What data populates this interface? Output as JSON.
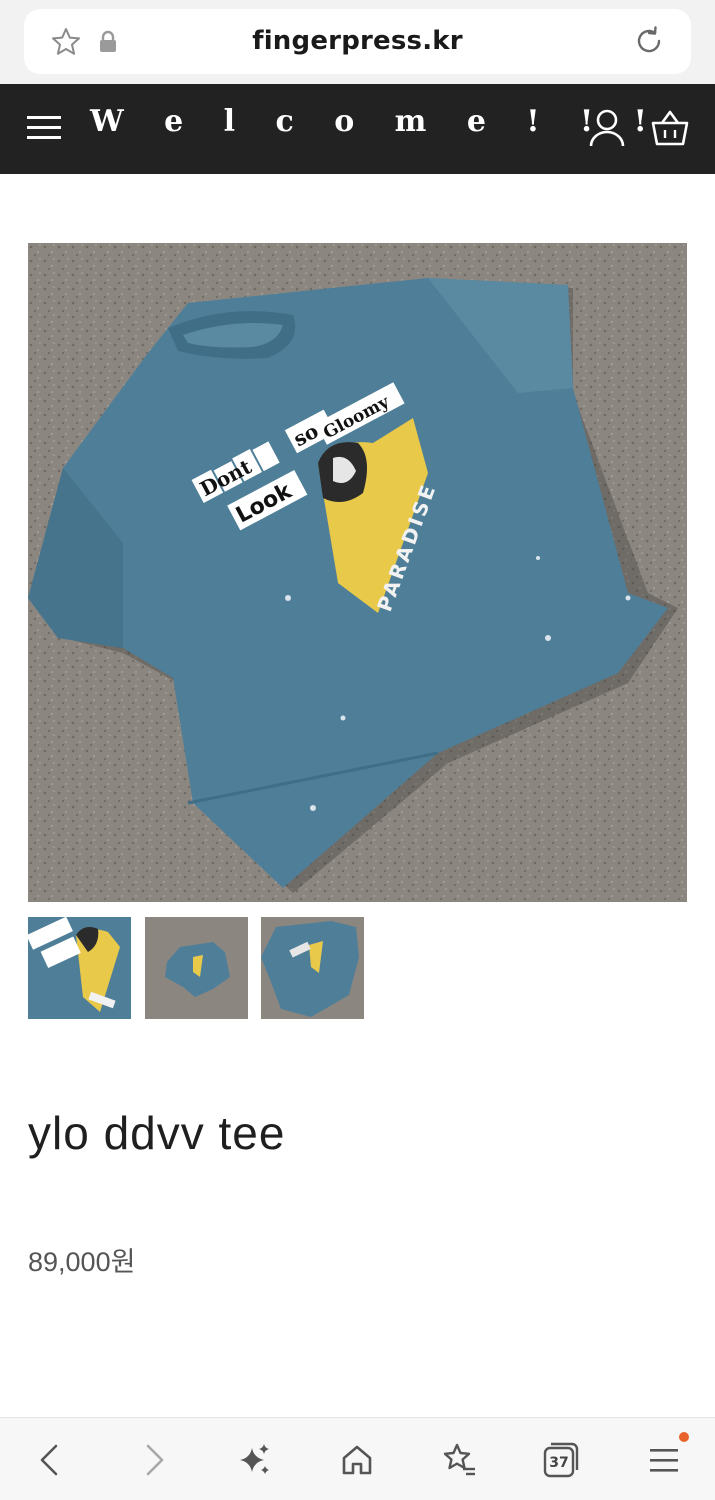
{
  "browser": {
    "url": "fingerpress.kr",
    "tab_count": "37"
  },
  "site": {
    "brand": "W e l c o m e ! ! !"
  },
  "product": {
    "name": "ylo ddvv tee",
    "price": "89,000원",
    "print_text": {
      "line1": "Dont",
      "line2": "so",
      "line3": "Look",
      "line4": "Gloomy",
      "side": "PARADISE"
    }
  },
  "colors": {
    "header_bg": "#222222",
    "shirt": "#4f7f98",
    "pavement": "#8a857e",
    "print_yellow": "#e9c94a",
    "notification": "#e8632b"
  }
}
